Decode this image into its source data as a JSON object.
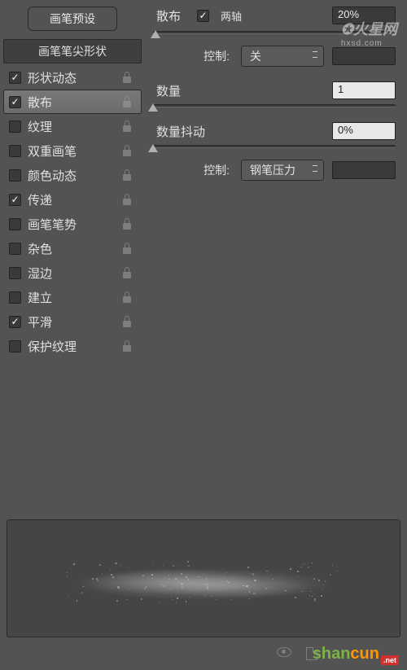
{
  "sidebar": {
    "preset_button": "画笔预设",
    "tip_shape_header": "画笔笔尖形状",
    "items": [
      {
        "label": "形状动态",
        "checked": true,
        "locked": true,
        "selected": false
      },
      {
        "label": "散布",
        "checked": true,
        "locked": true,
        "selected": true
      },
      {
        "label": "纹理",
        "checked": false,
        "locked": true,
        "selected": false
      },
      {
        "label": "双重画笔",
        "checked": false,
        "locked": true,
        "selected": false
      },
      {
        "label": "颜色动态",
        "checked": false,
        "locked": true,
        "selected": false
      },
      {
        "label": "传递",
        "checked": true,
        "locked": true,
        "selected": false
      },
      {
        "label": "画笔笔势",
        "checked": false,
        "locked": true,
        "selected": false
      },
      {
        "label": "杂色",
        "checked": false,
        "locked": true,
        "selected": false
      },
      {
        "label": "湿边",
        "checked": false,
        "locked": true,
        "selected": false
      },
      {
        "label": "建立",
        "checked": false,
        "locked": true,
        "selected": false
      },
      {
        "label": "平滑",
        "checked": true,
        "locked": true,
        "selected": false
      },
      {
        "label": "保护纹理",
        "checked": false,
        "locked": true,
        "selected": false
      }
    ]
  },
  "content": {
    "title": "散布",
    "both_axes_label": "两轴",
    "both_axes_checked": true,
    "scatter_value": "20%",
    "control1_label": "控制:",
    "control1_value": "关",
    "count_label": "数量",
    "count_value": "1",
    "count_jitter_label": "数量抖动",
    "count_jitter_value": "0%",
    "control2_label": "控制:",
    "control2_value": "钢笔压力"
  },
  "watermarks": {
    "top": "火星网",
    "top_sub": "hxsd.com",
    "bottom_a": "shan",
    "bottom_b": "cun",
    "bottom_net": ".net"
  }
}
